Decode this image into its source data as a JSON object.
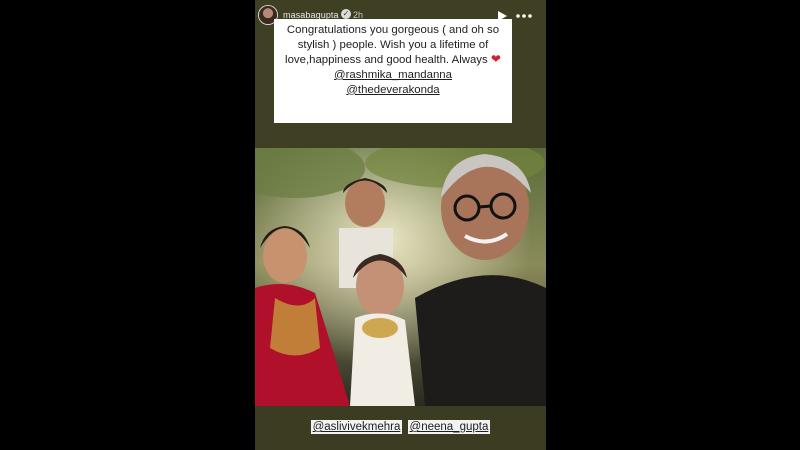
{
  "story": {
    "username": "masabagupta",
    "timestamp": "2h",
    "caption": {
      "text": "Congratulations you gorgeous ( and oh so stylish ) people. Wish you a lifetime of love,happiness and good health. Always",
      "heart": "❤",
      "mentions": [
        "@rashmika_mandanna",
        "@thedeverakonda"
      ]
    },
    "photo_tags": [
      "@aslivivekmehra",
      "@neena_gupta"
    ]
  },
  "colors": {
    "story_background": "#3f3f23",
    "caption_background": "#ffffff",
    "heart": "#d61f2c"
  },
  "icons": {
    "play": "play-icon",
    "more": "more-options-icon",
    "verified": "verified-badge-icon"
  }
}
